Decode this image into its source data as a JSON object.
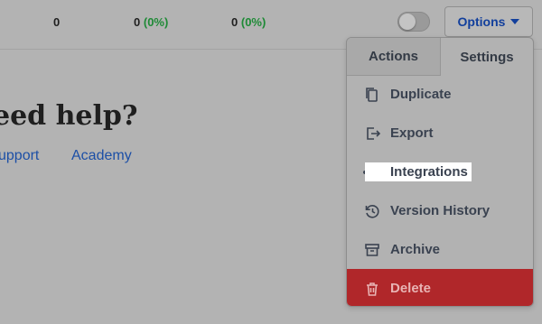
{
  "stats": [
    {
      "value": "0",
      "pct": ""
    },
    {
      "value": "0",
      "pct": "(0%)"
    },
    {
      "value": "0",
      "pct": "(0%)"
    }
  ],
  "options_button": {
    "label": "Options"
  },
  "page": {
    "heading": "eed help?",
    "links": [
      "upport",
      "Academy"
    ]
  },
  "dropdown": {
    "tabs": [
      "Actions",
      "Settings"
    ],
    "items": [
      {
        "label": "Duplicate",
        "icon": "duplicate-icon"
      },
      {
        "label": "Export",
        "icon": "export-icon"
      },
      {
        "label": "Integrations",
        "icon": "integrations-icon"
      },
      {
        "label": "Version History",
        "icon": "history-icon"
      },
      {
        "label": "Archive",
        "icon": "archive-icon"
      },
      {
        "label": "Delete",
        "icon": "trash-icon"
      }
    ]
  },
  "colors": {
    "accent": "#123f9c",
    "positive": "#1e8a36",
    "danger": "#b0272a",
    "link": "#1c4fa6"
  }
}
